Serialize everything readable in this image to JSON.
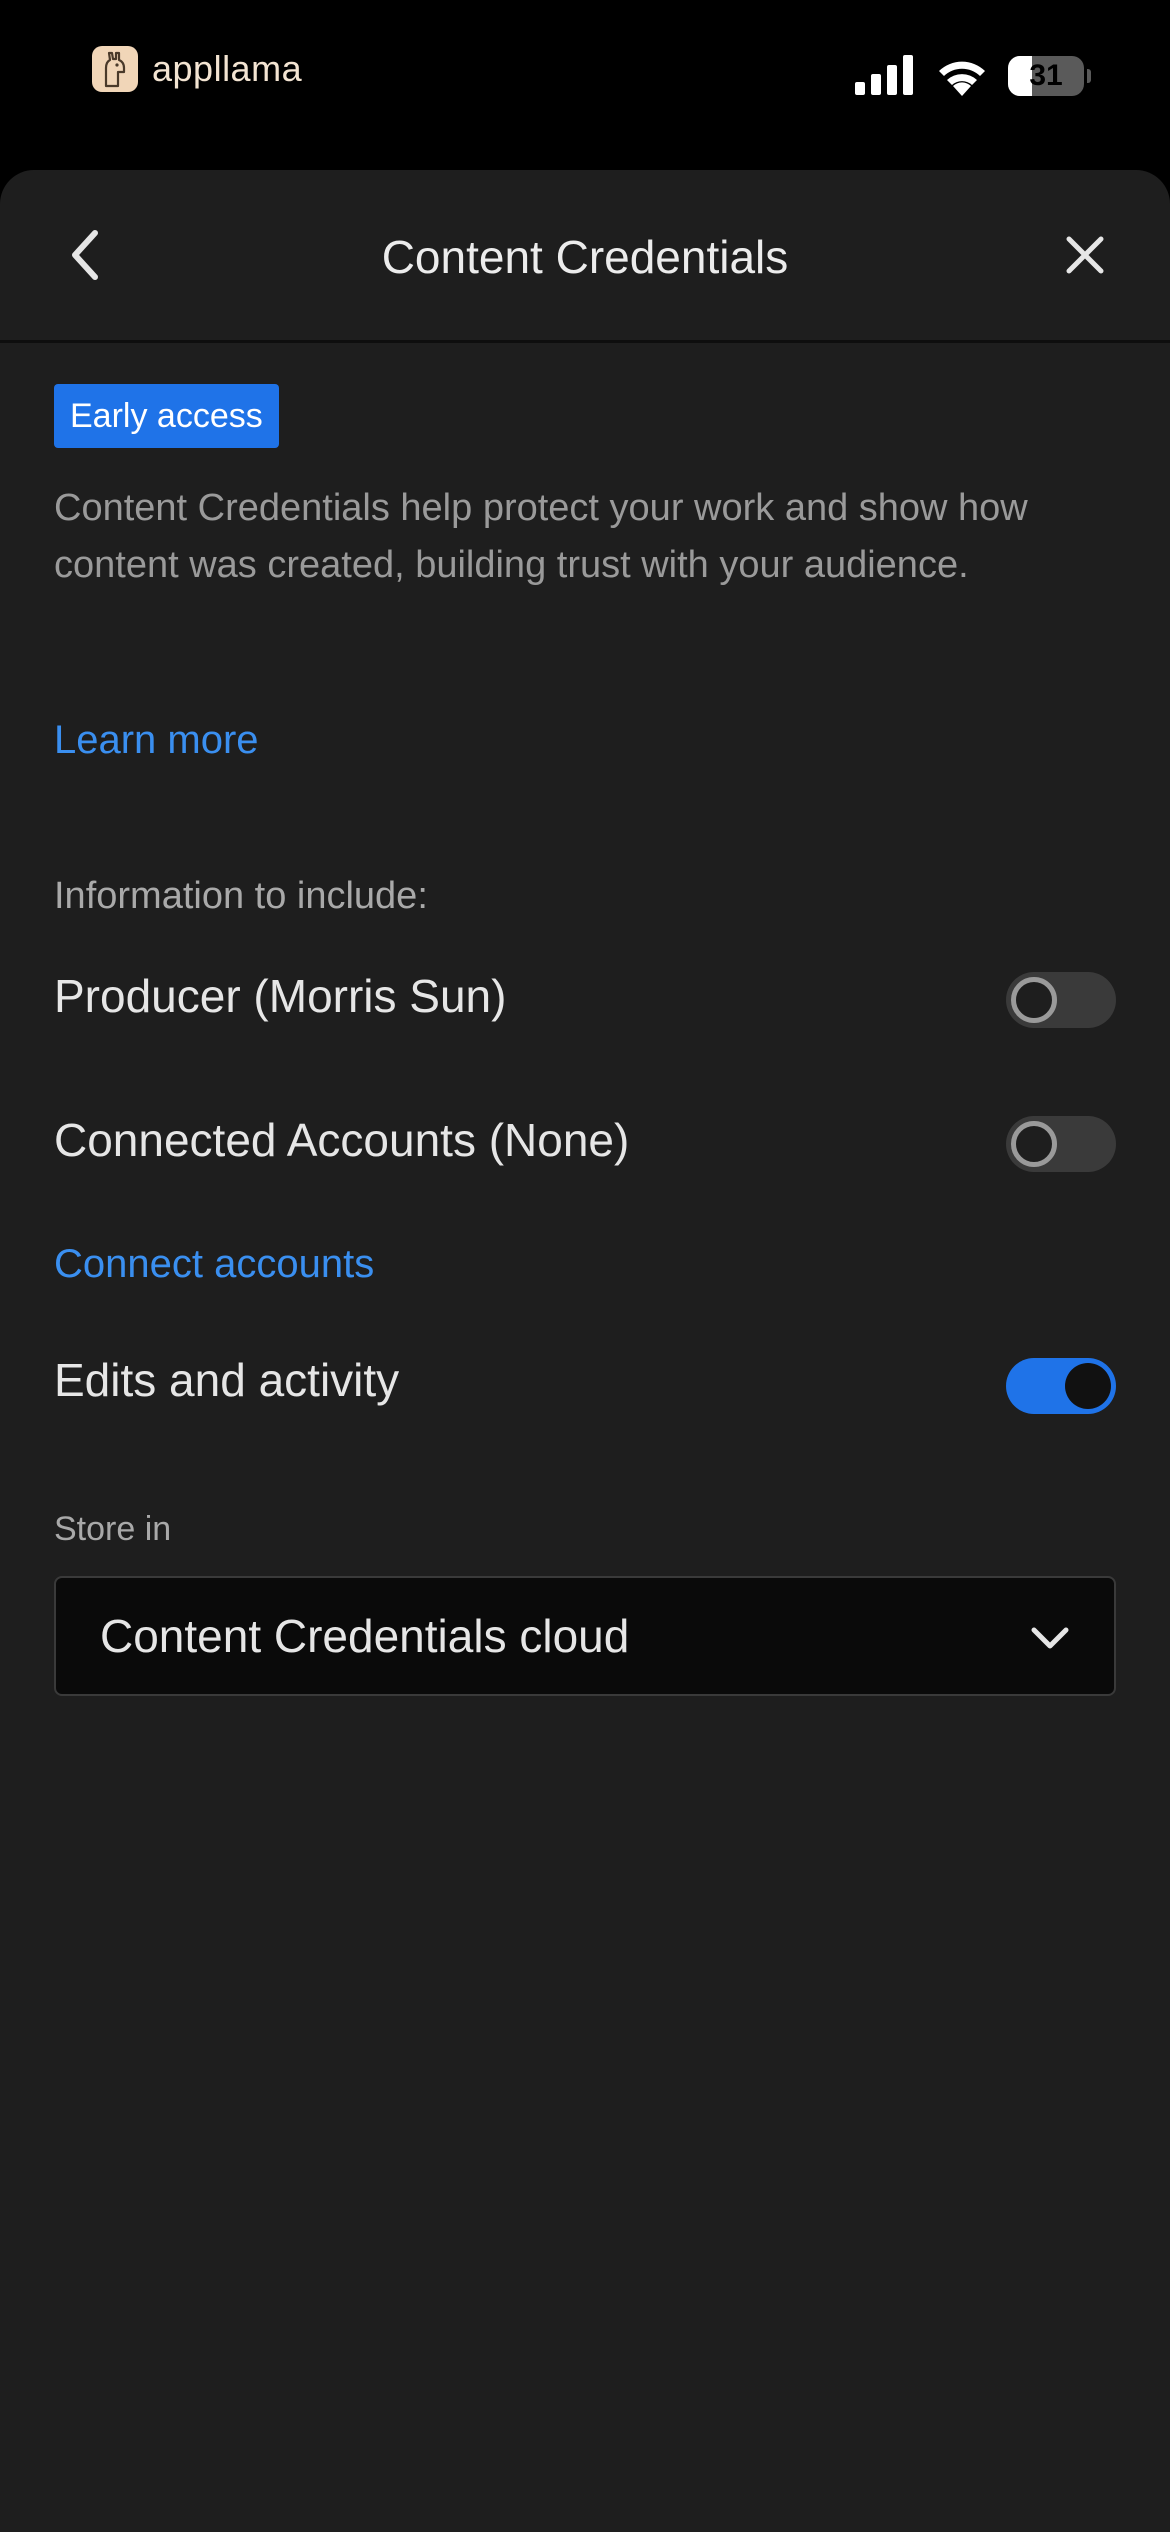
{
  "status_bar": {
    "brand_name": "appllama",
    "battery_level": "31",
    "battery_fraction": 0.31,
    "icons": [
      "signal-icon",
      "wifi-icon",
      "battery-icon"
    ]
  },
  "header": {
    "title": "Content Credentials",
    "back_icon": "chevron-left-icon",
    "close_icon": "close-icon"
  },
  "badge": {
    "label": "Early access",
    "color": "#1f73e8"
  },
  "description": "Content Credentials help protect your work and show how content was created, building trust with your audience.",
  "learn_more_label": "Learn more",
  "include_section": {
    "label": "Information to include:",
    "items": [
      {
        "label": "Producer (Morris Sun)",
        "enabled": false
      },
      {
        "label": "Connected Accounts (None)",
        "enabled": false
      },
      {
        "label": "Edits and activity",
        "enabled": true
      }
    ],
    "connect_accounts_label": "Connect accounts"
  },
  "store": {
    "label": "Store in",
    "selected": "Content Credentials cloud",
    "icon": "chevron-down-icon"
  },
  "colors": {
    "accent": "#1f73e8",
    "link": "#3a8ff0",
    "sheet_background": "#1e1e1e"
  }
}
